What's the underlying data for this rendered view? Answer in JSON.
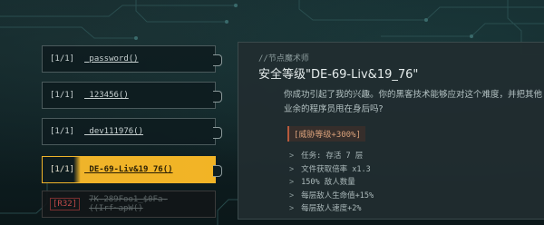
{
  "options": [
    {
      "tag": "[1/1]",
      "command": "_password()"
    },
    {
      "tag": "[1/1]",
      "command": "_123456()"
    },
    {
      "tag": "[1/1]",
      "command": "_dev111976()"
    },
    {
      "tag": "[1/1]",
      "command": "_DE-69-Liv&19_76()"
    },
    {
      "tag": "[R32]",
      "command": "7K-289Foo1_$0Fa-((Irf~apW()"
    }
  ],
  "dialog": {
    "npc_name": "//节点魔术师",
    "title": "安全等级\"DE-69-Liv&19_76\"",
    "message": "你成功引起了我的兴趣。你的黑客技术能够应对这个难度，并把其他业余的程序员甩在身后吗?",
    "threat_label": "[威胁等级+300%]",
    "modifiers": [
      "任务: 存活 7 层",
      "文件获取倍率 x1.3",
      "150% 敌人数量",
      "每层敌人生命值+15%",
      "每层敌人速度+2%"
    ]
  },
  "colors": {
    "selected": "#efb42a",
    "threat": "#b85a3c",
    "locked": "#c04a4a"
  }
}
